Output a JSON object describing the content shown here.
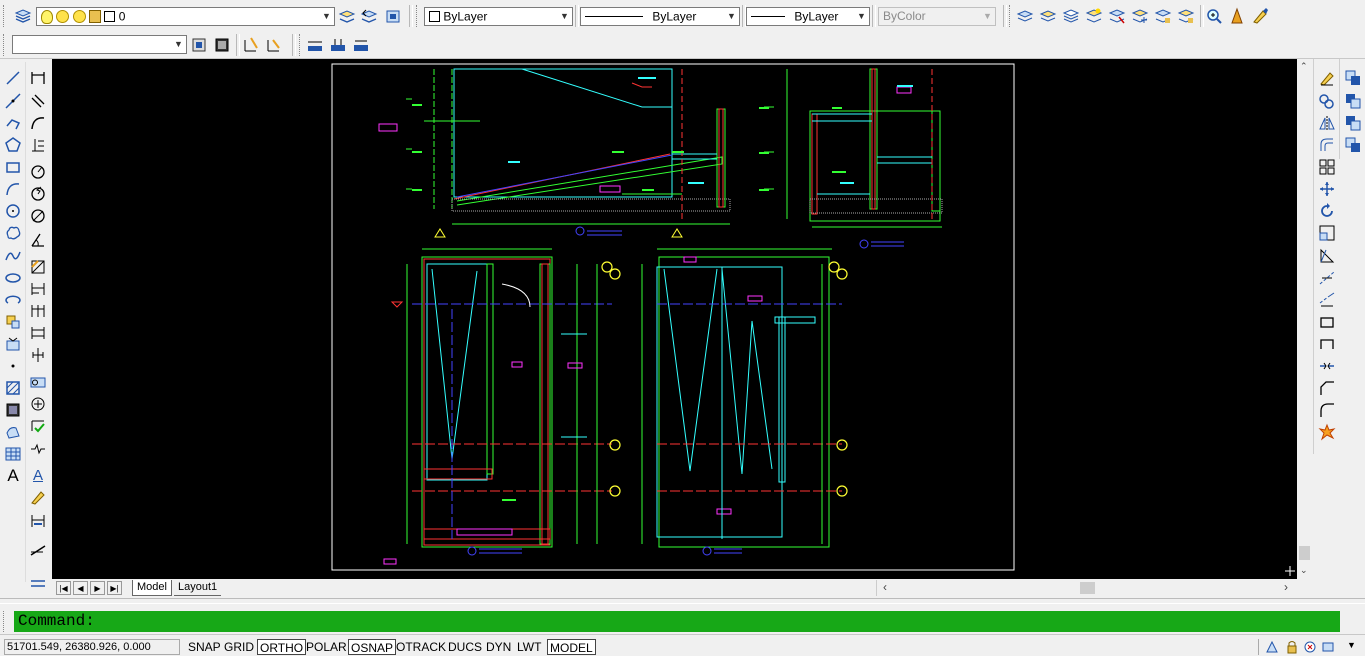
{
  "toolbar_top": {
    "layer_value": "0",
    "color_value": "ByLayer",
    "linetype_value": "ByLayer",
    "lineweight_value": "ByLayer",
    "plotstyle_value": "ByColor"
  },
  "toolbar_second": {
    "style_value": ""
  },
  "tabs": {
    "model": "Model",
    "layout1": "Layout1"
  },
  "command": {
    "prompt": "Command:"
  },
  "status": {
    "coords": "51701.549, 26380.926, 0.000",
    "snap": "SNAP",
    "grid": "GRID",
    "ortho": "ORTHO",
    "polar": "POLAR",
    "osnap": "OSNAP",
    "otrack": "OTRACK",
    "ducs": "DUCS",
    "dyn": "DYN",
    "lwt": "LWT",
    "model": "MODEL"
  },
  "colors": {
    "command_bg": "#17a817",
    "canvas_bg": "#000000",
    "cad_green": "#33ff33",
    "cad_cyan": "#33ffff",
    "cad_red": "#ff3333",
    "cad_blue": "#4444ff",
    "cad_magenta": "#ff33ff",
    "cad_yellow": "#ffff33"
  },
  "icons": [
    "layers-icon",
    "bulb-icon",
    "sun-icon",
    "lock-icon",
    "layer-previous-icon",
    "zoom-realtime-icon",
    "match-properties-icon",
    "distance-icon",
    "line-icon",
    "circle-icon",
    "text-icon",
    "hatch-icon",
    "move-icon",
    "rotate-icon",
    "scale-icon",
    "stretch-icon",
    "trim-icon",
    "extend-icon",
    "fillet-icon",
    "explode-icon"
  ]
}
